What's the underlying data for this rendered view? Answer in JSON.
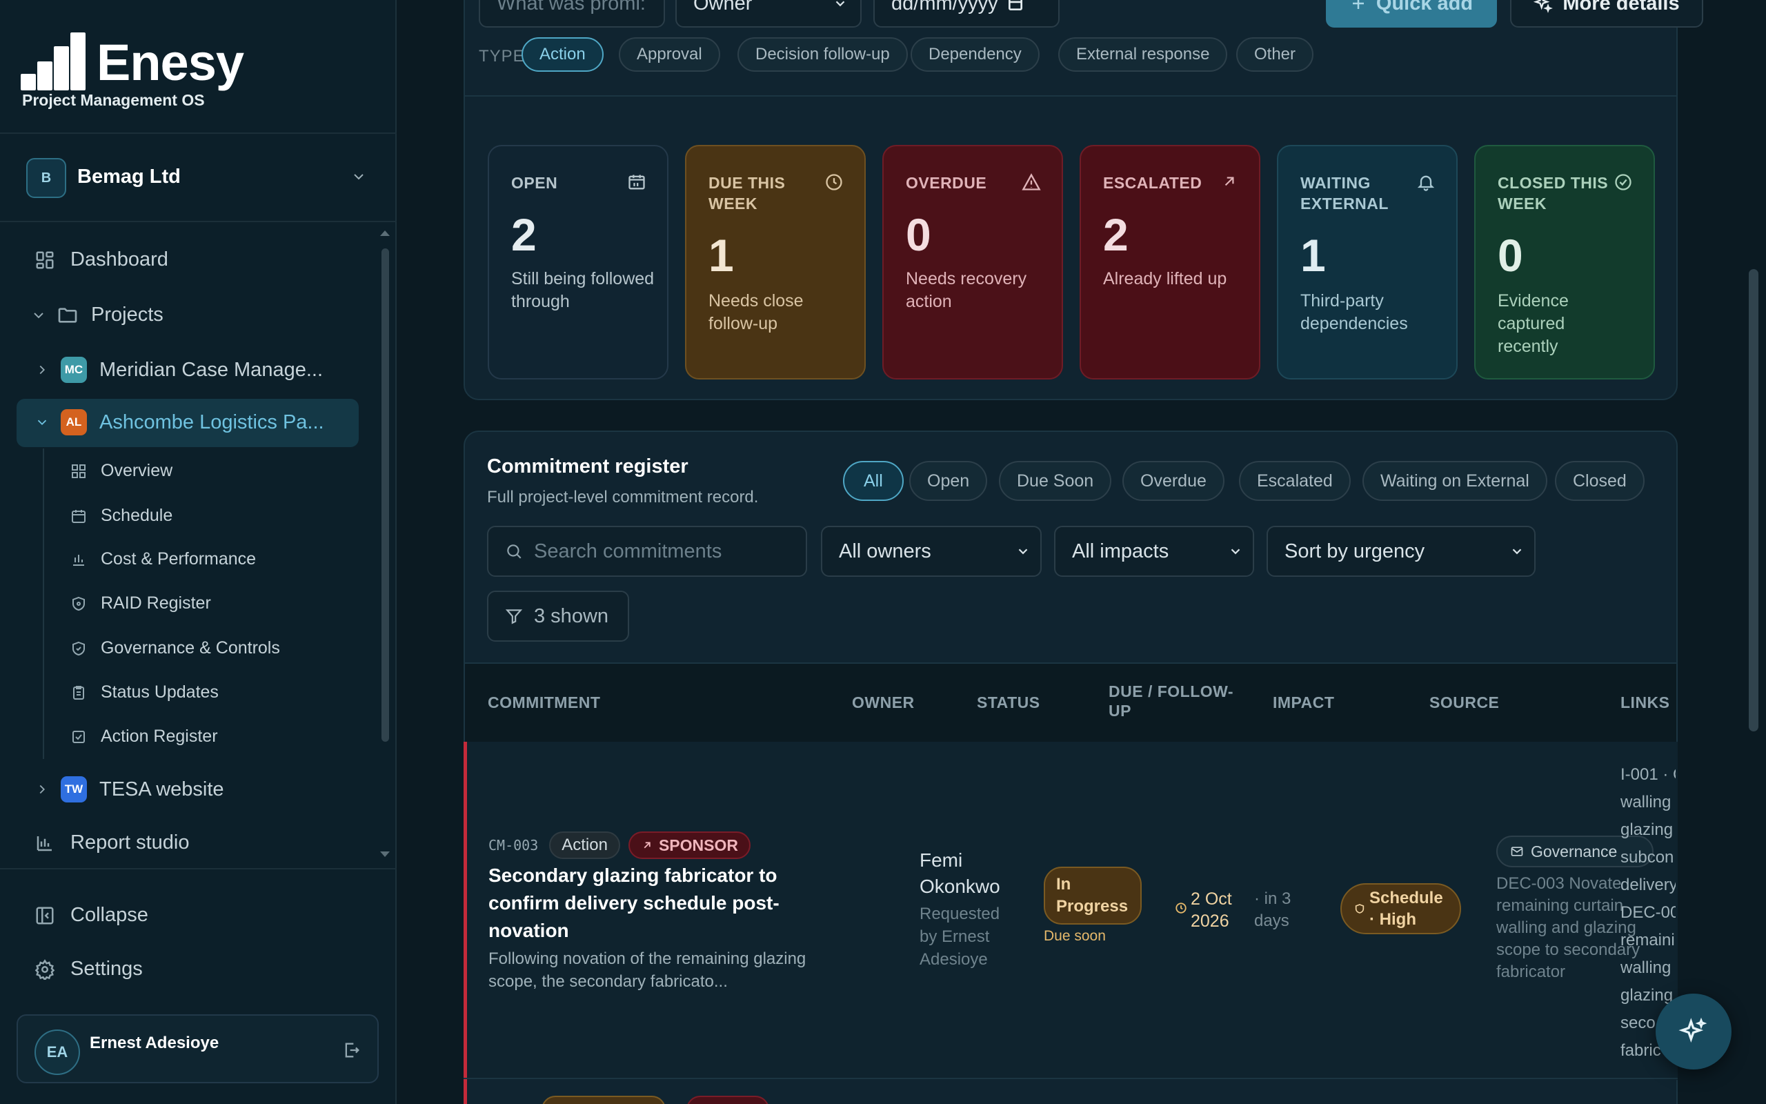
{
  "app": {
    "name": "Enesy",
    "tagline": "Project Management OS"
  },
  "org": {
    "initial": "B",
    "name": "Bemag Ltd"
  },
  "nav": {
    "dashboard": "Dashboard",
    "projects": "Projects",
    "project_items": [
      {
        "initials": "MC",
        "name": "Meridian Case Manage...",
        "color": "#3e9aa7"
      },
      {
        "initials": "AL",
        "name": "Ashcombe Logistics Pa...",
        "color": "#d4621f"
      },
      {
        "initials": "TW",
        "name": "TESA website",
        "color": "#2f6fe0"
      }
    ],
    "sub_items": [
      "Overview",
      "Schedule",
      "Cost & Performance",
      "RAID Register",
      "Governance & Controls",
      "Status Updates",
      "Action Register"
    ],
    "report_studio": "Report studio",
    "collapse": "Collapse",
    "settings": "Settings"
  },
  "user": {
    "initials": "EA",
    "name": "Ernest Adesioye"
  },
  "quick_form": {
    "promise_placeholder": "What was promi:",
    "owner": "Owner",
    "date_placeholder": "dd/mm/yyyy",
    "quick_add": "Quick add",
    "more_details": "More details"
  },
  "type_filter": {
    "label": "TYPE",
    "options": [
      "Action",
      "Approval",
      "Decision follow-up",
      "Dependency",
      "External response",
      "Other"
    ],
    "active": "Action"
  },
  "stats": [
    {
      "label": "OPEN",
      "value": "2",
      "desc": "Still being followed through",
      "icon": "calendar-icon"
    },
    {
      "label": "DUE THIS WEEK",
      "value": "1",
      "desc": "Needs close follow-up",
      "icon": "clock-icon"
    },
    {
      "label": "OVERDUE",
      "value": "0",
      "desc": "Needs recovery action",
      "icon": "warning-icon"
    },
    {
      "label": "ESCALATED",
      "value": "2",
      "desc": "Already lifted up",
      "icon": "arrow-up-right-icon"
    },
    {
      "label": "WAITING EXTERNAL",
      "value": "1",
      "desc": "Third-party dependencies",
      "icon": "bell-icon"
    },
    {
      "label": "CLOSED THIS WEEK",
      "value": "0",
      "desc": "Evidence captured recently",
      "icon": "check-circle-icon"
    }
  ],
  "register": {
    "title": "Commitment register",
    "subtitle": "Full project-level commitment record.",
    "status_tabs": [
      "All",
      "Open",
      "Due Soon",
      "Overdue",
      "Escalated",
      "Waiting on External",
      "Closed"
    ],
    "active_tab": "All",
    "search_placeholder": "Search commitments",
    "owners_filter": "All owners",
    "impacts_filter": "All impacts",
    "sort": "Sort by urgency",
    "shown": "3 shown",
    "columns": [
      "COMMITMENT",
      "OWNER",
      "STATUS",
      "DUE / FOLLOW-UP",
      "IMPACT",
      "SOURCE",
      "LINKS"
    ],
    "rows": [
      {
        "id": "CM-003",
        "type": "Action",
        "escalation": "SPONSOR",
        "title": "Secondary glazing fabricator to confirm delivery schedule post-novation",
        "summary": "Following novation of the remaining glazing scope, the secondary fabricato...",
        "owner": "Femi Okonkwo",
        "requested_by": "Requested by Ernest Adesioye",
        "status": "In Progress",
        "status_note": "Due soon",
        "due_date": "2 Oct 2026",
        "due_relative": "· in 3 days",
        "impact": "Schedule · High",
        "source_tag": "Governance",
        "source_desc": "DEC-003 Novate remaining curtain walling and glazing scope to secondary fabricator",
        "links": [
          "I-001 · C",
          "walling",
          "glazing",
          "subcon",
          "delivery",
          "DEC-00",
          "remaini",
          "walling",
          "glazing",
          "seco",
          "fabric"
        ]
      }
    ]
  },
  "colors": {
    "accent": "#4fa7c5",
    "danger": "#c42a3a",
    "warning": "#9a6a1a",
    "success": "#2e7a4c"
  }
}
